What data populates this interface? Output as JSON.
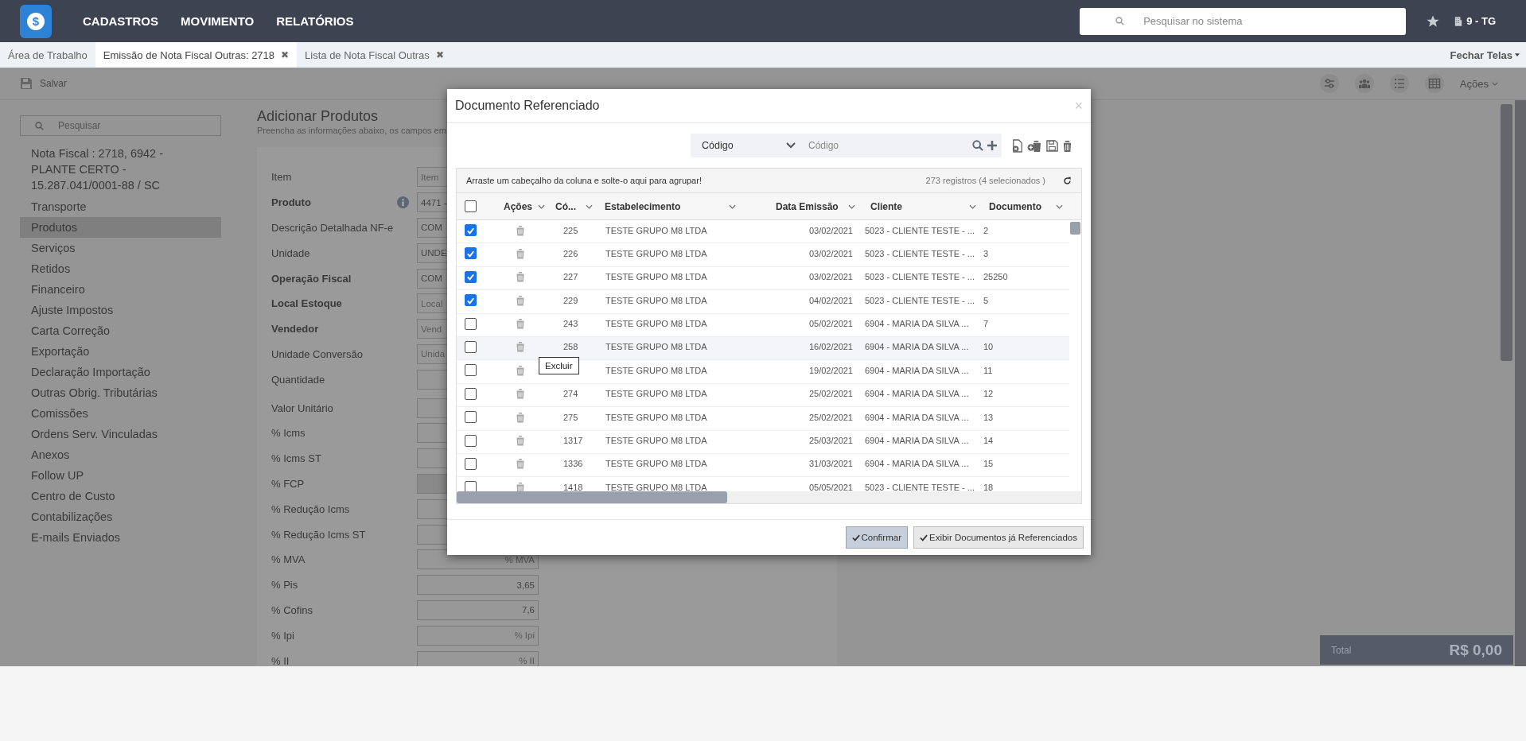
{
  "top_bar": {
    "logo_symbol": "$",
    "menu": [
      "CADASTROS",
      "MOVIMENTO",
      "RELATÓRIOS"
    ],
    "search": {
      "placeholder": "Pesquisar no sistema"
    },
    "user": "9 - TG"
  },
  "tabs": [
    {
      "label": "Área de Trabalho",
      "selected": false,
      "closable": false
    },
    {
      "label": "Emissão de Nota Fiscal Outras: 2718",
      "selected": true,
      "closable": true
    },
    {
      "label": "Lista de Nota Fiscal Outras",
      "selected": false,
      "closable": true
    }
  ],
  "tab_close": "✖",
  "close_all": "Fechar Telas",
  "toolbar": {
    "save": "Salvar",
    "actions": "Ações"
  },
  "sidebar": {
    "search": {
      "placeholder": "Pesquisar"
    },
    "title": "Nota Fiscal : 2718, 6942 - PLANTE CERTO - 15.287.041/0001-88 / SC",
    "items": [
      {
        "label": "Transporte",
        "selected": false
      },
      {
        "label": "Produtos",
        "selected": true
      },
      {
        "label": "Serviços",
        "selected": false
      },
      {
        "label": "Retidos",
        "selected": false
      },
      {
        "label": "Financeiro",
        "selected": false
      },
      {
        "label": "Ajuste Impostos",
        "selected": false
      },
      {
        "label": "Carta Correção",
        "selected": false
      },
      {
        "label": "Exportação",
        "selected": false
      },
      {
        "label": "Declaração Importação",
        "selected": false
      },
      {
        "label": "Outras Obrig. Tributárias",
        "selected": false
      },
      {
        "label": "Comissões",
        "selected": false
      },
      {
        "label": "Ordens Serv. Vinculadas",
        "selected": false
      },
      {
        "label": "Anexos",
        "selected": false
      },
      {
        "label": "Follow UP",
        "selected": false
      },
      {
        "label": "Centro de Custo",
        "selected": false
      },
      {
        "label": "Contabilizações",
        "selected": false
      },
      {
        "label": "E-mails Enviados",
        "selected": false
      }
    ]
  },
  "form": {
    "title": "Adicionar Produtos",
    "subtitle": "Preencha as informações abaixo, os campos em",
    "fields": [
      {
        "label": "Item",
        "bold": false,
        "placeholder": "Item"
      },
      {
        "label": "Produto",
        "bold": true,
        "info": true,
        "value": "4471 -"
      },
      {
        "label": "Descrição Detalhada NF-e",
        "bold": false,
        "value": "COM"
      },
      {
        "label": "Unidade",
        "bold": false,
        "value": "UNDE"
      },
      {
        "label": "Operação Fiscal",
        "bold": true,
        "value": "COM"
      },
      {
        "label": "Local Estoque",
        "bold": true,
        "placeholder": "Local"
      },
      {
        "label": "Vendedor",
        "bold": true,
        "placeholder": "Vend"
      },
      {
        "label": "Unidade Conversão",
        "bold": false,
        "placeholder": "Unida"
      },
      {
        "label": "Quantidade",
        "bold": false
      },
      {
        "label": "Valor Unitário",
        "bold": false
      },
      {
        "label": "% Icms",
        "bold": false
      },
      {
        "label": "% Icms ST",
        "bold": false
      },
      {
        "label": "% FCP",
        "bold": false,
        "disabled": true
      },
      {
        "label": "% Redução Icms",
        "bold": false
      },
      {
        "label": "% Redução Icms ST",
        "bold": false
      },
      {
        "label": "% MVA",
        "bold": false,
        "placeholder": "% MVA"
      },
      {
        "label": "% Pis",
        "bold": false,
        "value": "3,65"
      },
      {
        "label": "% Cofins",
        "bold": false,
        "value": "7,6"
      },
      {
        "label": "% Ipi",
        "bold": false,
        "placeholder": "% Ipi"
      },
      {
        "label": "% II",
        "bold": false,
        "placeholder": "% II"
      }
    ]
  },
  "modal": {
    "title": "Documento Referenciado",
    "close": "×",
    "search": {
      "field": "Código",
      "placeholder": "Código"
    },
    "group_hint": "Arraste um cabeçalho da coluna e solte-o aqui para agrupar!",
    "record_count": "273 registros (4 selecionados )",
    "select_all_checked": false,
    "columns": [
      "Ações",
      "Có...",
      "Estabelecimento",
      "Data Emissão",
      "Cliente",
      "Documento"
    ],
    "rows": [
      {
        "checked": true,
        "hovered": false,
        "code": "225",
        "establishment": "TESTE GRUPO M8 LTDA",
        "date": "03/02/2021",
        "client": "5023 - CLIENTE TESTE - ...",
        "document": "2"
      },
      {
        "checked": true,
        "hovered": false,
        "code": "226",
        "establishment": "TESTE GRUPO M8 LTDA",
        "date": "03/02/2021",
        "client": "5023 - CLIENTE TESTE - ...",
        "document": "3"
      },
      {
        "checked": true,
        "hovered": false,
        "code": "227",
        "establishment": "TESTE GRUPO M8 LTDA",
        "date": "03/02/2021",
        "client": "5023 - CLIENTE TESTE - ...",
        "document": "25250"
      },
      {
        "checked": true,
        "hovered": false,
        "code": "229",
        "establishment": "TESTE GRUPO M8 LTDA",
        "date": "04/02/2021",
        "client": "5023 - CLIENTE TESTE - ...",
        "document": "5"
      },
      {
        "checked": false,
        "hovered": false,
        "code": "243",
        "establishment": "TESTE GRUPO M8 LTDA",
        "date": "05/02/2021",
        "client": "6904 - MARIA DA SILVA ...",
        "document": "7"
      },
      {
        "checked": false,
        "hovered": true,
        "code": "258",
        "establishment": "TESTE GRUPO M8 LTDA",
        "date": "16/02/2021",
        "client": "6904 - MARIA DA SILVA ...",
        "document": "10"
      },
      {
        "checked": false,
        "hovered": false,
        "establishment": "TESTE GRUPO M8 LTDA",
        "date": "19/02/2021",
        "client": "6904 - MARIA DA SILVA ...",
        "document": "11"
      },
      {
        "checked": false,
        "hovered": false,
        "code": "274",
        "establishment": "TESTE GRUPO M8 LTDA",
        "date": "25/02/2021",
        "client": "6904 - MARIA DA SILVA ...",
        "document": "12"
      },
      {
        "checked": false,
        "hovered": false,
        "code": "275",
        "establishment": "TESTE GRUPO M8 LTDA",
        "date": "25/02/2021",
        "client": "6904 - MARIA DA SILVA ...",
        "document": "13"
      },
      {
        "checked": false,
        "hovered": false,
        "code": "1317",
        "establishment": "TESTE GRUPO M8 LTDA",
        "date": "25/03/2021",
        "client": "6904 - MARIA DA SILVA ...",
        "document": "14"
      },
      {
        "checked": false,
        "hovered": false,
        "code": "1336",
        "establishment": "TESTE GRUPO M8 LTDA",
        "date": "31/03/2021",
        "client": "6904 - MARIA DA SILVA ...",
        "document": "15"
      },
      {
        "checked": false,
        "hovered": false,
        "code": "1418",
        "establishment": "TESTE GRUPO M8 LTDA",
        "date": "05/05/2021",
        "client": "5023 - CLIENTE TESTE - ...",
        "document": "18"
      }
    ],
    "tooltip": "Excluir",
    "buttons": [
      {
        "label": "Confirmar",
        "primary": true
      },
      {
        "label": "Exibir Documentos já Referenciados",
        "primary": false
      }
    ]
  },
  "total": {
    "label": "Total",
    "value": "R$ 0,00"
  }
}
